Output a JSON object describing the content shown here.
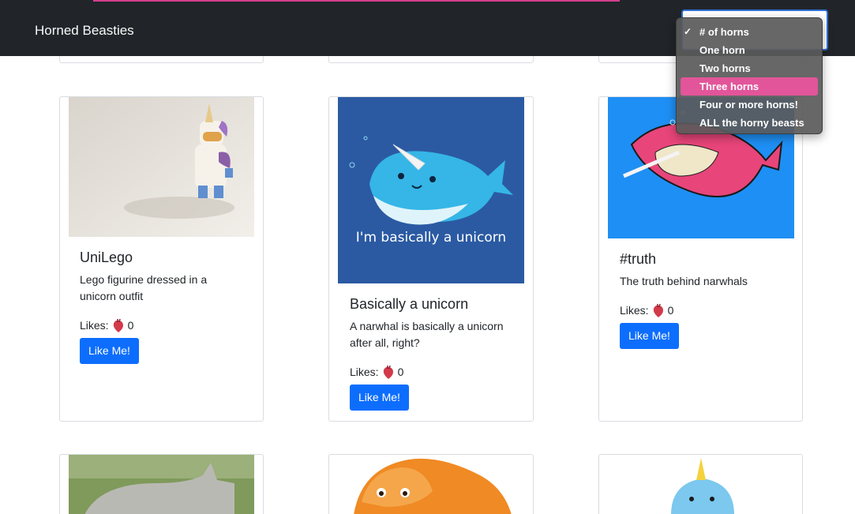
{
  "navbar": {
    "brand": "Horned Beasties",
    "filter_select": {
      "options": [
        {
          "label": "# of horns",
          "checked": true
        },
        {
          "label": "One horn"
        },
        {
          "label": "Two horns"
        },
        {
          "label": "Three horns",
          "highlighted": true
        },
        {
          "label": "Four or more horns!"
        },
        {
          "label": "ALL the horny beasts"
        }
      ]
    }
  },
  "likes_label": "Likes:",
  "cards": [
    {
      "title": "UniLego",
      "description": "Lego figurine dressed in a unicorn outfit",
      "likes": "0",
      "button": "Like Me!"
    },
    {
      "title": "Basically a unicorn",
      "description": "A narwhal is basically a unicorn after all, right?",
      "likes": "0",
      "button": "Like Me!",
      "image_text": "I'm basically a unicorn"
    },
    {
      "title": "#truth",
      "description": "The truth behind narwhals",
      "likes": "0",
      "button": "Like Me!"
    }
  ],
  "colors": {
    "navbar": "#212529",
    "button": "#0d6efd",
    "menu_highlight": "#e2559a",
    "accent": "#d43f8d"
  }
}
